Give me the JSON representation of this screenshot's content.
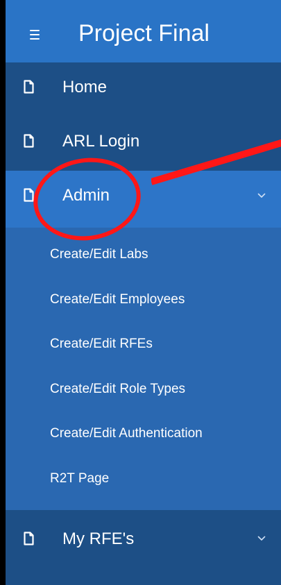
{
  "header": {
    "title": "Project Final",
    "menu_icon": "hamburger-menu-icon"
  },
  "nav": {
    "items": [
      {
        "label": "Home",
        "icon": "page-icon"
      },
      {
        "label": "ARL Login",
        "icon": "page-icon"
      },
      {
        "label": "Admin",
        "icon": "page-icon",
        "expanded": true
      },
      {
        "label": "My RFE's",
        "icon": "page-icon",
        "expanded": false
      }
    ]
  },
  "submenu": {
    "items": [
      {
        "label": "Create/Edit Labs"
      },
      {
        "label": "Create/Edit Employees"
      },
      {
        "label": "Create/Edit RFEs"
      },
      {
        "label": "Create/Edit Role Types"
      },
      {
        "label": "Create/Edit Authentication"
      },
      {
        "label": "R2T Page"
      }
    ]
  },
  "colors": {
    "header_bg": "#2a74c6",
    "sidebar_bg": "#1d4f86",
    "active_bg": "#2d75c8",
    "submenu_bg": "#2a68b1",
    "annotation": "#ff1717"
  }
}
